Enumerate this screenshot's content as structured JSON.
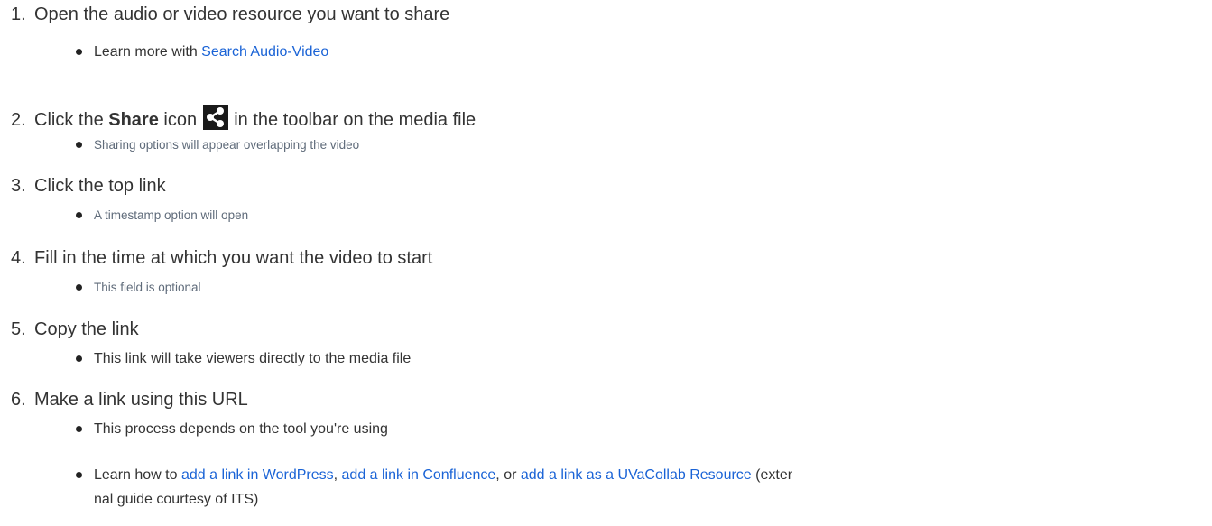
{
  "steps": [
    {
      "num": "1.",
      "text": "Open the audio or video resource you want to share",
      "bullets": [
        {
          "prefix": "Learn more with ",
          "link": "Search Audio-Video"
        }
      ]
    },
    {
      "num": "2.",
      "text_before": "Click the ",
      "bold": "Share",
      "text_mid": " icon ",
      "icon": "share-icon",
      "text_after": " in the toolbar on the media file",
      "bullets": [
        {
          "text": "Sharing options will appear overlapping the video"
        }
      ]
    },
    {
      "num": "3.",
      "text": "Click the top link",
      "bullets": [
        {
          "text": "A timestamp option will open"
        }
      ]
    },
    {
      "num": "4.",
      "text": "Fill in the time at which you want the video to start",
      "bullets": [
        {
          "text": "This field is optional"
        }
      ]
    },
    {
      "num": "5.",
      "text": "Copy the link",
      "bullets": [
        {
          "text": "This link will take viewers directly to the media file"
        }
      ]
    },
    {
      "num": "6.",
      "text": "Make a link using this URL",
      "bullets": [
        {
          "text": "This process depends on the tool you're using"
        },
        {
          "prefix": "Learn how to ",
          "link1": "add a link in WordPress",
          "sep1": ", ",
          "link2": "add a link in Confluence",
          "sep2": ", or ",
          "link3": "add a link as a UVaCollab Resource",
          "suffix_line1": " (exter",
          "suffix_line2": "nal guide courtesy of ITS)"
        }
      ]
    }
  ],
  "colors": {
    "text": "#333333",
    "muted": "#5f6b7a",
    "link": "#1a63d6",
    "icon_bg": "#1a1a1a"
  }
}
